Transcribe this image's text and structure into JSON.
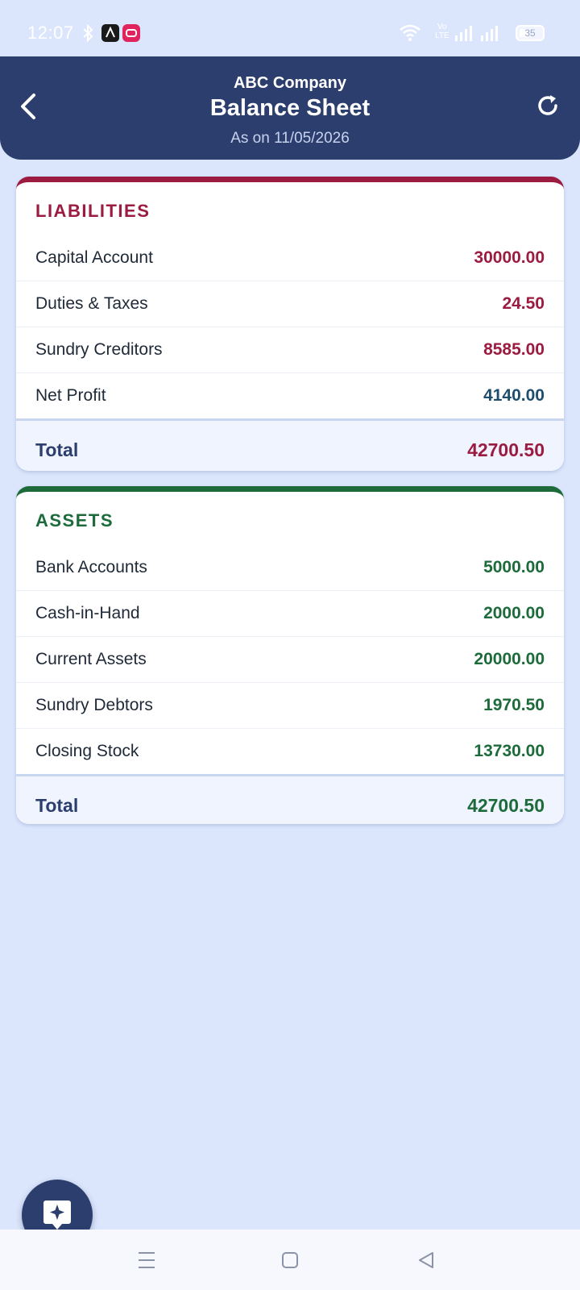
{
  "status_bar": {
    "time": "12:07",
    "network_label_top": "Vo",
    "network_label_bottom": "LTE",
    "battery_level": "35"
  },
  "header": {
    "company": "ABC Company",
    "title": "Balance Sheet",
    "as_on": "As on 11/05/2026",
    "back_icon": "chevron-left-icon",
    "refresh_icon": "refresh-icon"
  },
  "liabilities": {
    "title": "LIABILITIES",
    "accent_color": "#9b1b41",
    "items": [
      {
        "label": "Capital Account",
        "amount": "30000.00",
        "color": "#9b1b41"
      },
      {
        "label": "Duties & Taxes",
        "amount": "24.50",
        "color": "#9b1b41"
      },
      {
        "label": "Sundry Creditors",
        "amount": "8585.00",
        "color": "#9b1b41"
      },
      {
        "label": "Net Profit",
        "amount": "4140.00",
        "color": "#1e4e6e"
      }
    ],
    "total_label": "Total",
    "total_amount": "42700.50"
  },
  "assets": {
    "title": "ASSETS",
    "accent_color": "#1d6b3a",
    "items": [
      {
        "label": "Bank Accounts",
        "amount": "5000.00",
        "color": "#1d6b3a"
      },
      {
        "label": "Cash-in-Hand",
        "amount": "2000.00",
        "color": "#1d6b3a"
      },
      {
        "label": "Current Assets",
        "amount": "20000.00",
        "color": "#1d6b3a"
      },
      {
        "label": "Sundry Debtors",
        "amount": "1970.50",
        "color": "#1d6b3a"
      },
      {
        "label": "Closing Stock",
        "amount": "13730.00",
        "color": "#1d6b3a"
      }
    ],
    "total_label": "Total",
    "total_amount": "42700.50"
  },
  "fab": {
    "icon": "sparkle-chat-icon"
  },
  "nav": {
    "menu_icon": "menu-icon",
    "home_icon": "home-square-icon",
    "back_icon": "back-triangle-icon"
  }
}
